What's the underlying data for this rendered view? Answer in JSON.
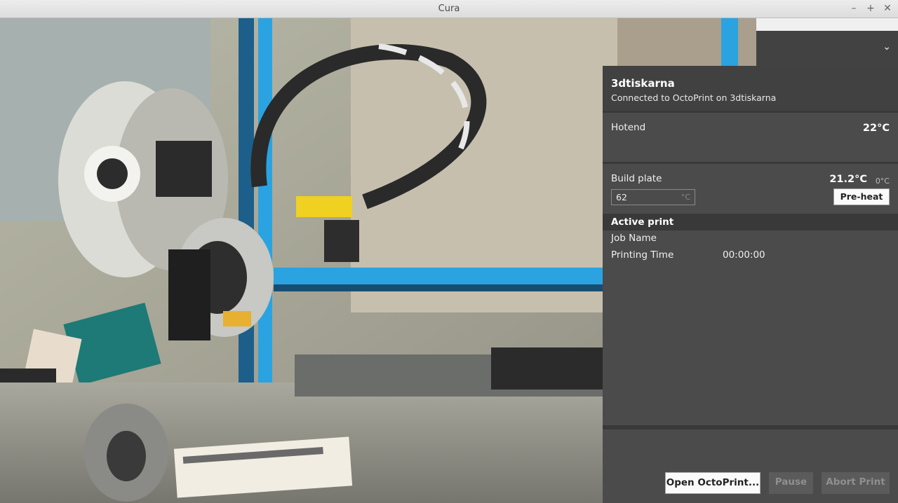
{
  "window": {
    "title": "Cura",
    "controls": {
      "minimize": "–",
      "maximize": "+",
      "close": "✕"
    }
  },
  "printer_selector": {
    "chevron_icon": "chevron-down-icon"
  },
  "monitor": {
    "printer_name": "3dtiskarna",
    "connection_status": "Connected to OctoPrint on 3dtiskarna",
    "hotend": {
      "label": "Hotend",
      "temperature": "22°C"
    },
    "build_plate": {
      "label": "Build plate",
      "temperature": "21.2°C",
      "target": "0°C",
      "input_value": "62",
      "input_unit": "°C",
      "preheat_label": "Pre-heat"
    },
    "active_print": {
      "heading": "Active print",
      "job_name_label": "Job Name",
      "printing_time_label": "Printing Time",
      "printing_time_value": "00:00:00"
    },
    "buttons": {
      "open_octoprint": "Open OctoPrint...",
      "pause": "Pause",
      "abort": "Abort Print"
    }
  },
  "colors": {
    "panel_bg": "#4b4b4b",
    "panel_header_bg": "#414141",
    "divider": "#393939",
    "button_light": "#fafafa",
    "button_disabled": "#5b5b5b",
    "frame_blue": "#2aa3e0",
    "carriage_yellow": "#f0d020"
  }
}
